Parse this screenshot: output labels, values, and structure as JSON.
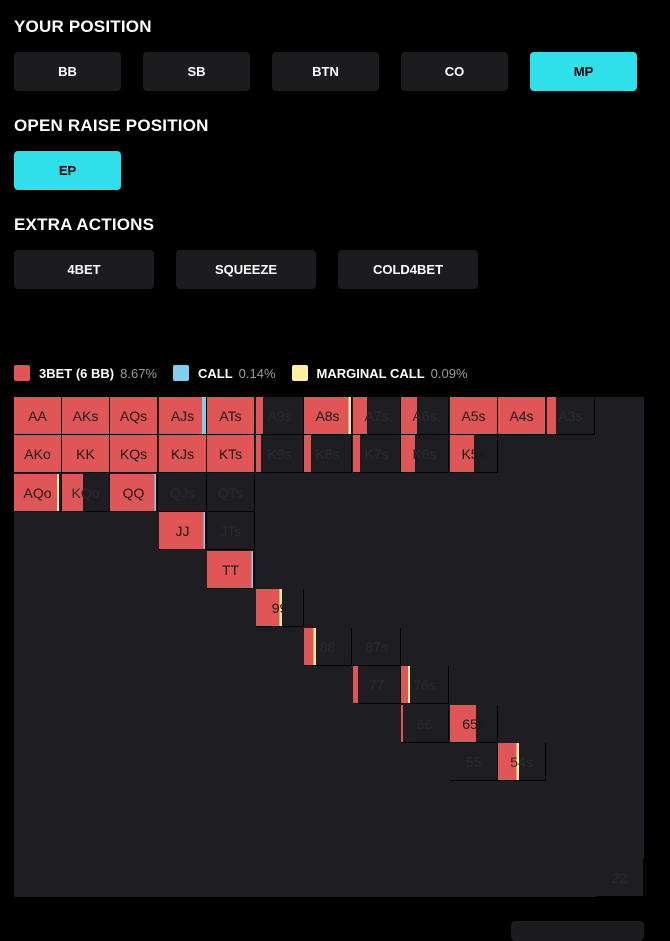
{
  "sections": {
    "your_position": "YOUR POSITION",
    "open_raise_position": "OPEN RAISE POSITION",
    "extra_actions": "EXTRA ACTIONS"
  },
  "positions": [
    "BB",
    "SB",
    "BTN",
    "CO",
    "MP"
  ],
  "selected_position": "MP",
  "open_raise": [
    "EP"
  ],
  "selected_open_raise": "EP",
  "extra_actions": [
    "4BET",
    "SQUEEZE",
    "COLD4BET"
  ],
  "legend": [
    {
      "label": "3BET (6 BB)",
      "pct": "8.67%",
      "color": "#e05555"
    },
    {
      "label": "CALL",
      "pct": "0.14%",
      "color": "#7fd0ef"
    },
    {
      "label": "MARGINAL CALL",
      "pct": "0.09%",
      "color": "#fff1a0"
    }
  ],
  "colors": {
    "raise": "#e05555",
    "call": "#7fd0ef",
    "marginal": "#fff1a0",
    "cell_bg": "#1e1e22",
    "active": "#2fe0ea"
  },
  "hands": [
    {
      "label": "AA",
      "raise": 1
    },
    {
      "label": "AKs",
      "raise": 1
    },
    {
      "label": "AQs",
      "raise": 1
    },
    {
      "label": "AJs",
      "raise": 0.92,
      "call": 0.08
    },
    {
      "label": "ATs",
      "raise": 1
    },
    {
      "label": "A9s",
      "raise": 0.15
    },
    {
      "label": "A8s",
      "raise": 0.95,
      "marginal": 0.05
    },
    {
      "label": "A7s",
      "raise": 0.3
    },
    {
      "label": "A6s",
      "raise": 0.35
    },
    {
      "label": "A5s",
      "raise": 1
    },
    {
      "label": "A4s",
      "raise": 1
    },
    {
      "label": "A3s",
      "raise": 0.2
    },
    {
      "label": "AKo",
      "raise": 1
    },
    {
      "label": "KK",
      "raise": 1
    },
    {
      "label": "KQs",
      "raise": 1
    },
    {
      "label": "KJs",
      "raise": 1
    },
    {
      "label": "KTs",
      "raise": 1
    },
    {
      "label": "K9s",
      "raise": 0.1
    },
    {
      "label": "K8s",
      "raise": 0.15
    },
    {
      "label": "K7s",
      "raise": 0.15
    },
    {
      "label": "K6s",
      "raise": 0.3
    },
    {
      "label": "K5s",
      "raise": 0.5
    },
    {
      "label": "AQo",
      "raise": 0.92,
      "marginal": 0.04
    },
    {
      "label": "KQo",
      "raise": 0.45
    },
    {
      "label": "QQ",
      "raise": 0.95,
      "call": 0.03
    },
    {
      "label": "QJs"
    },
    {
      "label": "QTs"
    },
    {
      "label": "JJ",
      "raise": 0.95,
      "call": 0.03
    },
    {
      "label": "JTs"
    },
    {
      "label": "TT",
      "raise": 0.95,
      "call": 0.03
    },
    {
      "label": "99",
      "raise": 0.5,
      "marginal": 0.05
    },
    {
      "label": "88",
      "raise": 0.2,
      "marginal": 0.05
    },
    {
      "label": "87s"
    },
    {
      "label": "77",
      "raise": 0.1
    },
    {
      "label": "76s",
      "raise": 0.15,
      "marginal": 0.05
    },
    {
      "label": "66",
      "raise": 0.05
    },
    {
      "label": "65s",
      "raise": 0.55
    },
    {
      "label": "55"
    },
    {
      "label": "54s",
      "raise": 0.4,
      "marginal": 0.05
    },
    {
      "label": "22"
    }
  ]
}
